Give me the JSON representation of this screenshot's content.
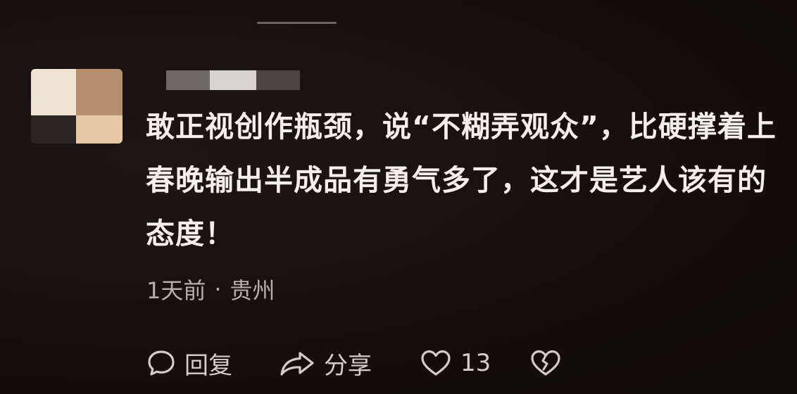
{
  "comment": {
    "text": "敢正视创作瓶颈，说“不糊弄观众”，比硬撑着上春晚输出半成品有勇气多了，这才是艺人该有的态度！",
    "time": "1天前",
    "separator": "·",
    "location": "贵州"
  },
  "actions": {
    "reply_label": "回复",
    "share_label": "分享",
    "like_count": "13"
  },
  "icons": {
    "reply": "comment-bubble-icon",
    "share": "share-arrow-icon",
    "like": "heart-icon",
    "dislike": "broken-heart-icon"
  }
}
